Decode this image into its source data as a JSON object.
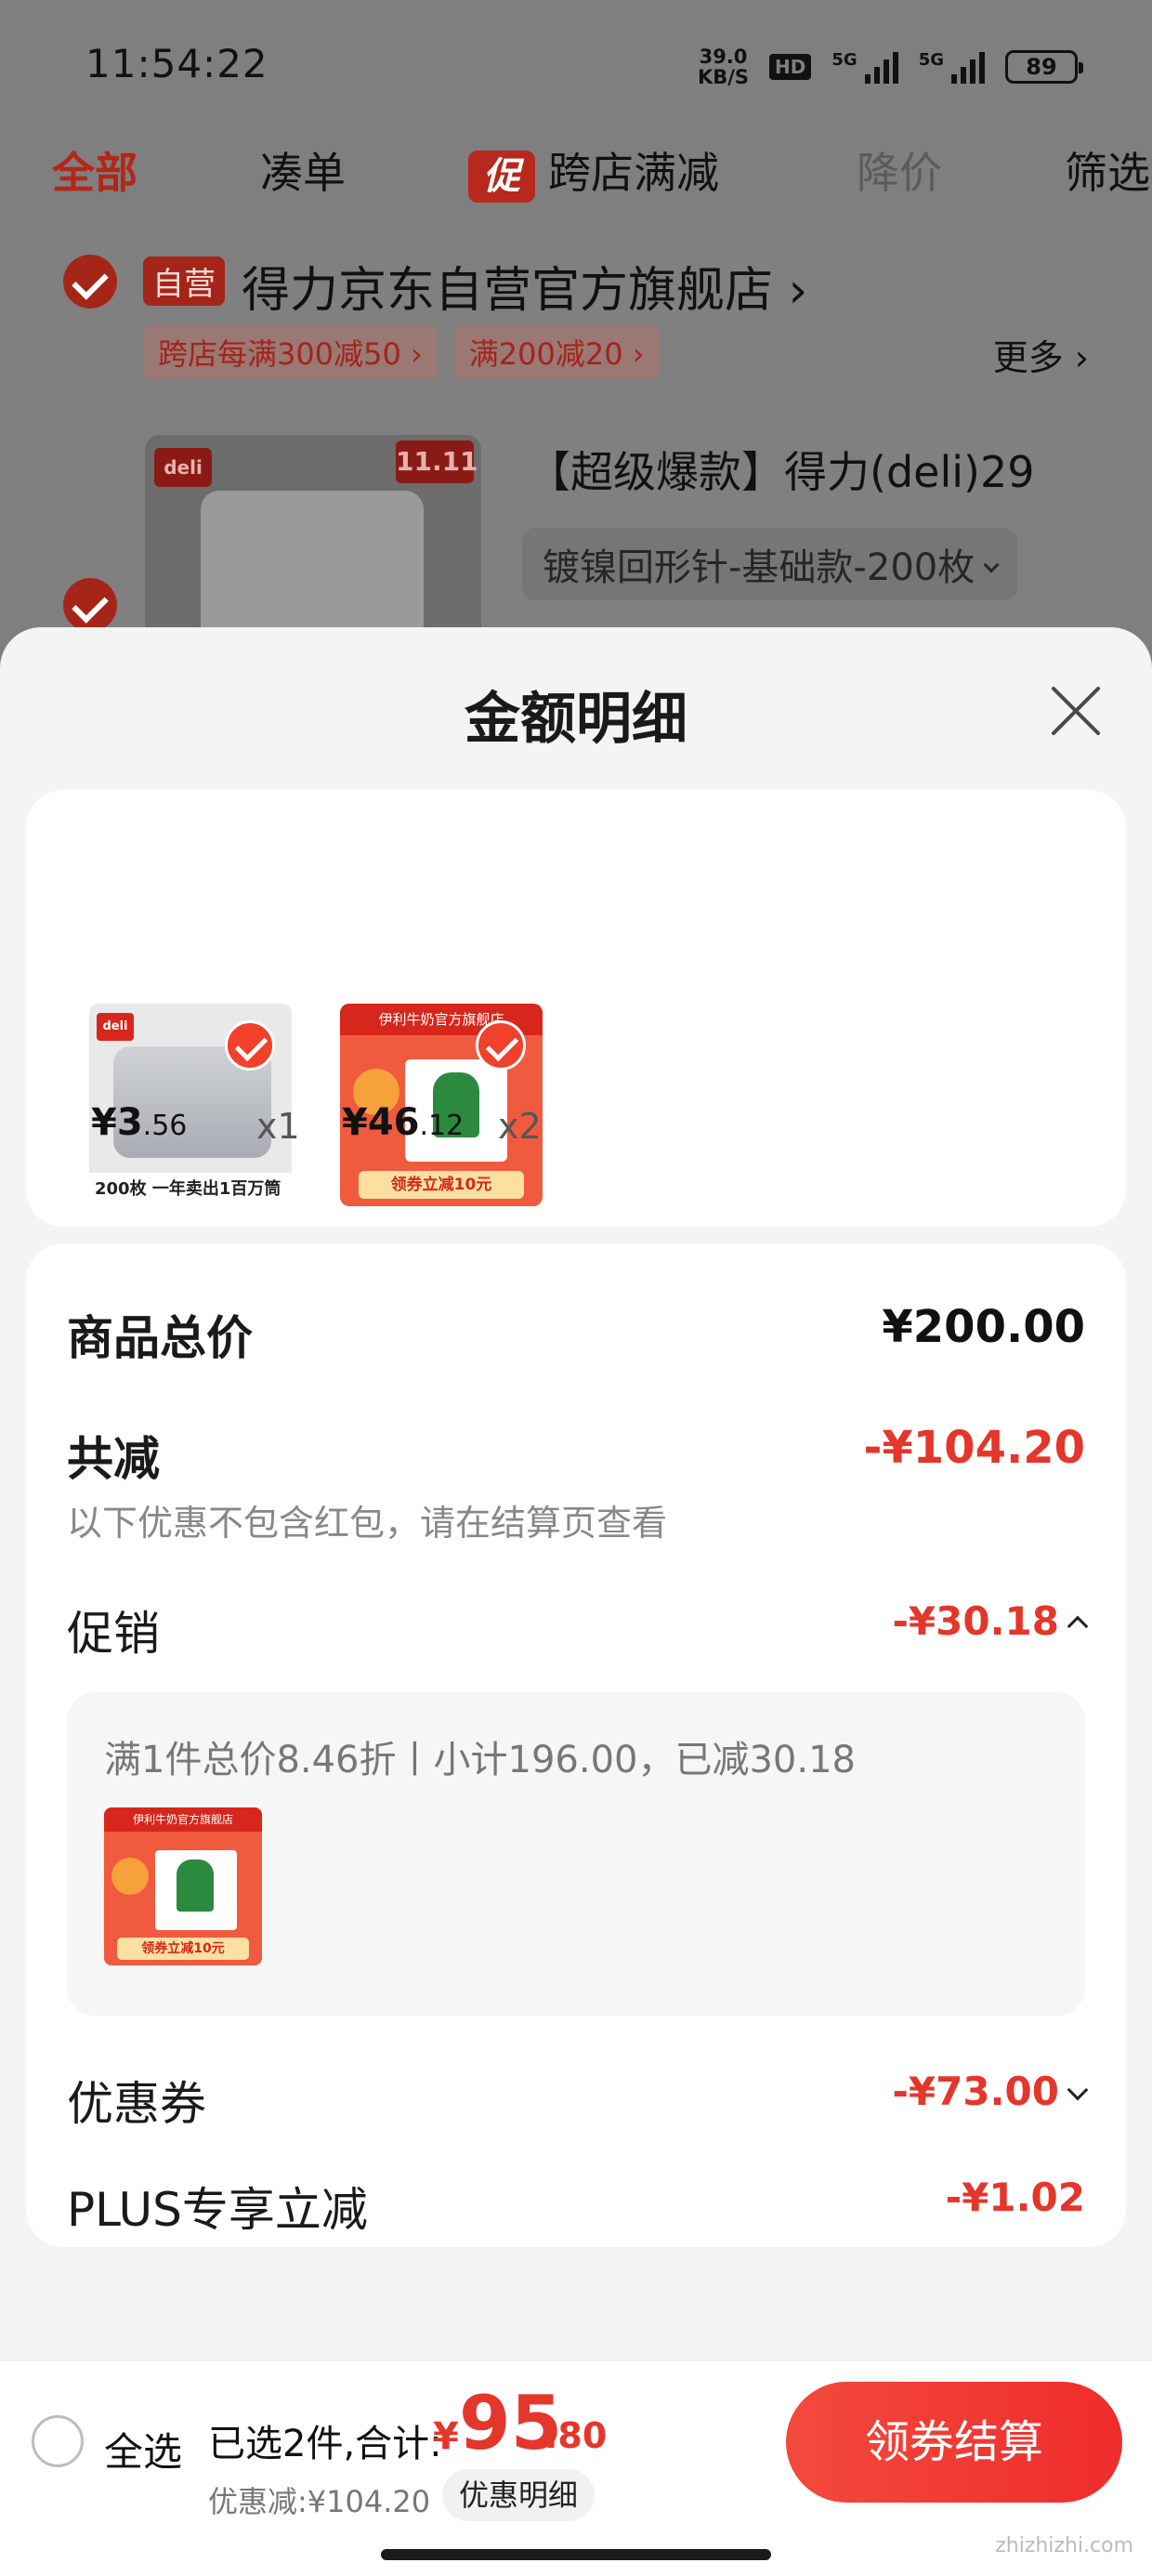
{
  "status_bar": {
    "time": "11:54:22",
    "net_speed_value": "39.0",
    "net_speed_unit": "KB/S",
    "hd": "HD",
    "signal_1": "5G",
    "signal_2": "5G",
    "battery": "89"
  },
  "filter_tabs": {
    "all": "全部",
    "bundle": "凑单",
    "promo_icon": "促",
    "cross_store": "跨店满减",
    "price_drop": "降价",
    "filter": "筛选"
  },
  "store": {
    "self_badge": "自营",
    "name": "得力京东自营官方旗舰店 ›",
    "promo_1": "跨店每满300减50 ›",
    "promo_2": "满200减20 ›",
    "more": "更多 ›"
  },
  "cart_item": {
    "brand": "deli",
    "event_tag": "11.11",
    "title": "【超级爆款】得力(deli)29",
    "sku": "镀镍回形针-基础款-200枚"
  },
  "sheet": {
    "title": "金额明细",
    "products": [
      {
        "price_int": "¥3",
        "price_dec": ".56",
        "qty": "x1",
        "brand": "deli",
        "foot": "200枚 一年卖出1百万筒"
      },
      {
        "price_int": "¥46",
        "price_dec": ".12",
        "qty": "x2",
        "top_banner": "伊利牛奶官方旗舰店",
        "bottom_banner": "领券立减10元"
      }
    ],
    "total_label": "商品总价",
    "total_value": "¥200.00",
    "reduce_label": "共减",
    "reduce_value": "-¥104.20",
    "reduce_note": "以下优惠不包含红包，请在结算页查看",
    "promo_label": "促销",
    "promo_value": "-¥30.18",
    "promo_desc": "满1件总价8.46折丨小计196.00，已减30.18",
    "coupon_label": "优惠券",
    "coupon_value": "-¥73.00",
    "plus_label": "PLUS专享立减",
    "plus_value": "-¥1.02"
  },
  "footer": {
    "select_all": "全选",
    "summary": "已选2件,合计:",
    "currency": "¥",
    "total_int": "95",
    "total_dec": ".80",
    "discount": "优惠减:¥104.20",
    "detail_chip": "优惠明细",
    "checkout": "领券结算"
  },
  "watermark": "zhizhizhi.com"
}
